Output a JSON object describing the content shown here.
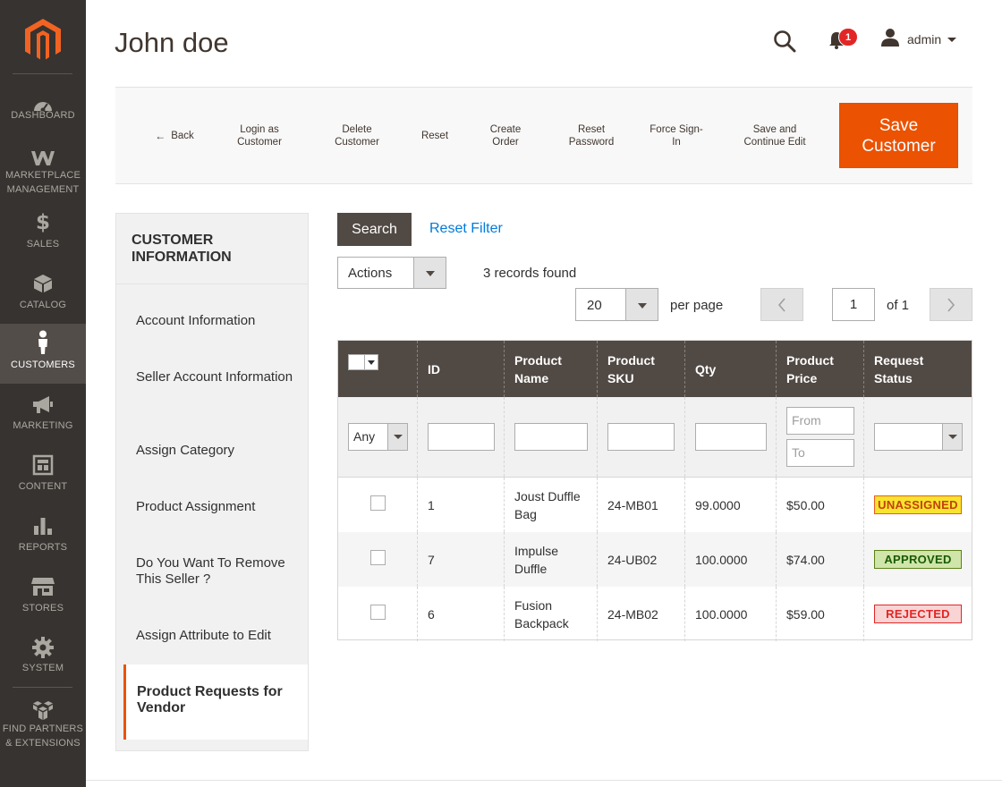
{
  "sidebar": {
    "logo": "magento-logo",
    "items": [
      {
        "label": "DASHBOARD",
        "icon": "dashboard-icon"
      },
      {
        "label": "MARKETPLACE MANAGEMENT",
        "icon": "marketplace-icon"
      },
      {
        "label": "SALES",
        "icon": "dollar-icon"
      },
      {
        "label": "CATALOG",
        "icon": "cube-icon"
      },
      {
        "label": "CUSTOMERS",
        "icon": "person-icon",
        "active": true
      },
      {
        "label": "MARKETING",
        "icon": "megaphone-icon"
      },
      {
        "label": "CONTENT",
        "icon": "layout-icon"
      },
      {
        "label": "REPORTS",
        "icon": "bar-chart-icon"
      },
      {
        "label": "STORES",
        "icon": "store-icon"
      },
      {
        "label": "SYSTEM",
        "icon": "gear-icon"
      },
      {
        "label": "FIND PARTNERS & EXTENSIONS",
        "icon": "boxes-icon"
      }
    ]
  },
  "header": {
    "title": "John doe",
    "notifications_count": "1",
    "user_name": "admin"
  },
  "toolbar": {
    "back": "Back",
    "login_as_customer": "Login as Customer",
    "delete_customer": "Delete Customer",
    "reset": "Reset",
    "create_order": "Create Order",
    "reset_password": "Reset Password",
    "force_sign_in": "Force Sign-In",
    "save_continue": "Save and Continue Edit",
    "save_customer": "Save Customer"
  },
  "side_panel": {
    "title": "CUSTOMER INFORMATION",
    "tabs": [
      "Account Information",
      "Seller Account Information",
      "Assign Category",
      "Product Assignment",
      "Do You Want To Remove This Seller ?",
      "Assign Attribute to Edit"
    ],
    "active_tab": "Product Requests for Vendor"
  },
  "grid_controls": {
    "search_label": "Search",
    "reset_filter_label": "Reset Filter",
    "actions_label": "Actions",
    "records_found": "3 records found",
    "per_page_value": "20",
    "per_page_label": "per page",
    "page_value": "1",
    "page_of": "of 1"
  },
  "table": {
    "columns": [
      "ID",
      "Product Name",
      "Product SKU",
      "Qty",
      "Product Price",
      "Request Status"
    ],
    "filters": {
      "any_label": "Any",
      "price_from_placeholder": "From",
      "price_to_placeholder": "To"
    },
    "rows": [
      {
        "id": "1",
        "name": "Joust Duffle Bag",
        "sku": "24-MB01",
        "qty": "99.0000",
        "price": "$50.00",
        "status": "UNASSIGNED"
      },
      {
        "id": "7",
        "name": "Impulse Duffle",
        "sku": "24-UB02",
        "qty": "100.0000",
        "price": "$74.00",
        "status": "APPROVED"
      },
      {
        "id": "6",
        "name": "Fusion Backpack",
        "sku": "24-MB02",
        "qty": "100.0000",
        "price": "$59.00",
        "status": "REJECTED"
      }
    ]
  },
  "colors": {
    "sidebar_bg": "#373330",
    "accent": "#eb5202",
    "header_bg": "#514943",
    "link": "#007bdb",
    "status_unassigned": "#f8e32f",
    "status_approved": "#d0e5a9",
    "status_rejected": "#f9d4d4"
  }
}
